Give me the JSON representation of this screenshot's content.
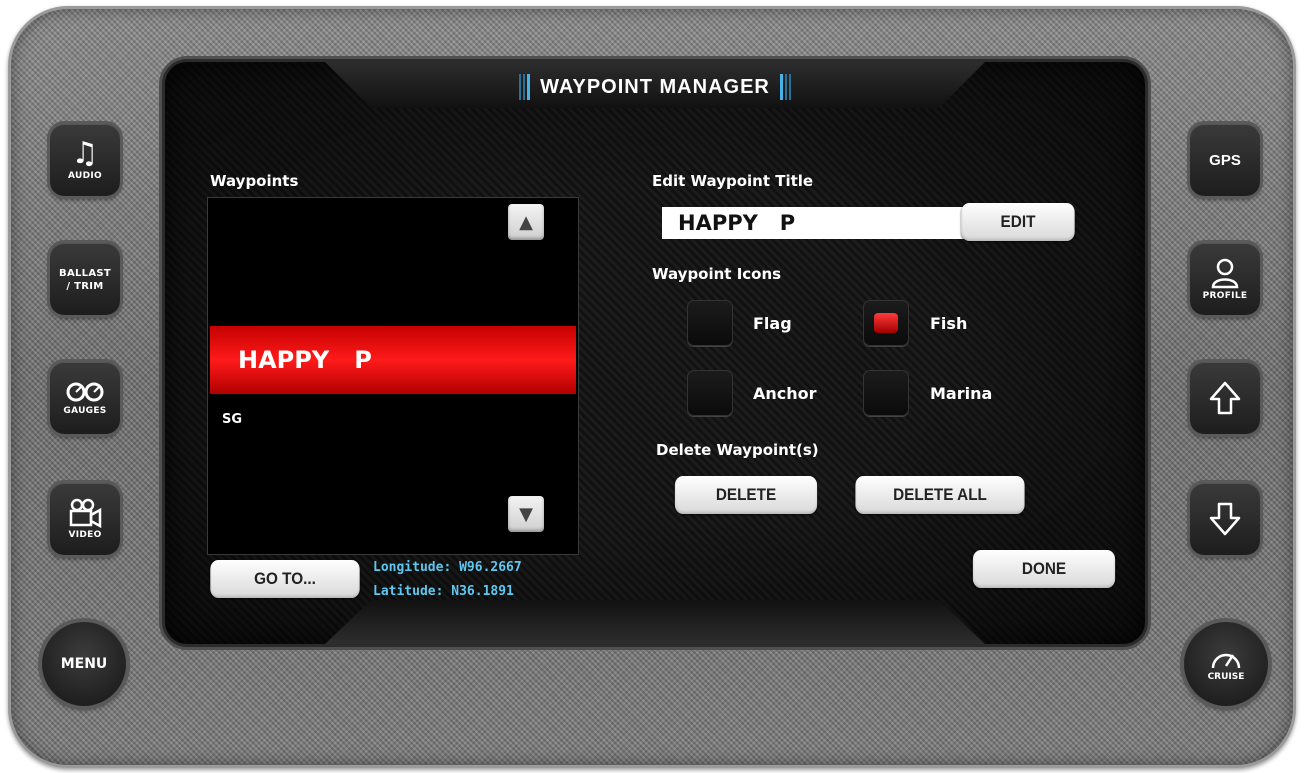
{
  "header": {
    "title": "WAYPOINT MANAGER"
  },
  "waypoints": {
    "heading": "Waypoints",
    "items": [
      "HAPPY   P",
      "SG"
    ],
    "scroll_up_icon": "triangle-up",
    "scroll_down_icon": "triangle-down"
  },
  "edit": {
    "heading": "Edit Waypoint Title",
    "value": "HAPPY   P",
    "edit_label": "EDIT"
  },
  "icons": {
    "heading": "Waypoint Icons",
    "options": [
      "Flag",
      "Fish",
      "Anchor",
      "Marina"
    ],
    "selected": "Fish",
    "selected_color": "#e00000"
  },
  "delete": {
    "heading": "Delete Waypoint(s)",
    "delete_label": "DELETE",
    "delete_all_label": "DELETE ALL"
  },
  "done_label": "DONE",
  "goto_label": "GO TO...",
  "coordinates": {
    "longitude": "Longitude: W96.2667",
    "latitude": "Latitude: N36.1891"
  },
  "side_left": {
    "audio": "AUDIO",
    "ballast": "BALLAST\n/ TRIM",
    "ballast_line1": "BALLAST",
    "ballast_line2": "/ TRIM",
    "gauges": "GAUGES",
    "video": "VIDEO",
    "menu": "MENU"
  },
  "side_right": {
    "gps": "GPS",
    "profile": "PROFILE",
    "cruise": "CRUISE"
  },
  "colors": {
    "accent_blue": "#45b3e6",
    "selection_red": "#e00000",
    "coord_text": "#5fc8f0"
  }
}
